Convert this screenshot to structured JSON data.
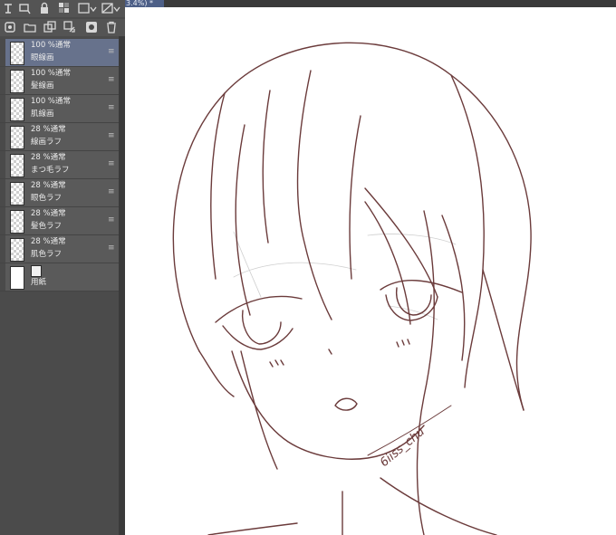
{
  "tab": {
    "zoom_label": "3.4%)",
    "marker": "*"
  },
  "toolbar_top": {
    "icons": [
      "layer-settings-icon",
      "clip-icon",
      "lock-icon",
      "transparency-lock-icon",
      "color-icon",
      "mask-icon"
    ]
  },
  "toolbar_second": {
    "icons": [
      "new-layer-icon",
      "new-folder-icon",
      "copy-layer-icon",
      "merge-layer-icon",
      "mask-create-icon",
      "trash-icon"
    ]
  },
  "layers": [
    {
      "mode": "100 %通常",
      "name": "眼線画",
      "selected": true,
      "thumb": "checker"
    },
    {
      "mode": "100 %通常",
      "name": "髪線画",
      "selected": false,
      "thumb": "checker"
    },
    {
      "mode": "100 %通常",
      "name": "肌線画",
      "selected": false,
      "thumb": "checker"
    },
    {
      "mode": "28 %通常",
      "name": "線画ラフ",
      "selected": false,
      "thumb": "checker"
    },
    {
      "mode": "28 %通常",
      "name": "まつ毛ラフ",
      "selected": false,
      "thumb": "checker"
    },
    {
      "mode": "28 %通常",
      "name": "眼色ラフ",
      "selected": false,
      "thumb": "checker"
    },
    {
      "mode": "28 %通常",
      "name": "髪色ラフ",
      "selected": false,
      "thumb": "checker"
    },
    {
      "mode": "28 %通常",
      "name": "肌色ラフ",
      "selected": false,
      "thumb": "checker"
    },
    {
      "mode": "",
      "name": "用紙",
      "selected": false,
      "thumb": "white"
    }
  ],
  "canvas": {
    "signature": "6iiss_chu",
    "line_color": "#6b3b3b",
    "rough_color": "#cfcfcf"
  },
  "colors": {
    "panel": "#4b4b4b",
    "selected_layer": "#67728c",
    "tab": "#4d5f87"
  }
}
